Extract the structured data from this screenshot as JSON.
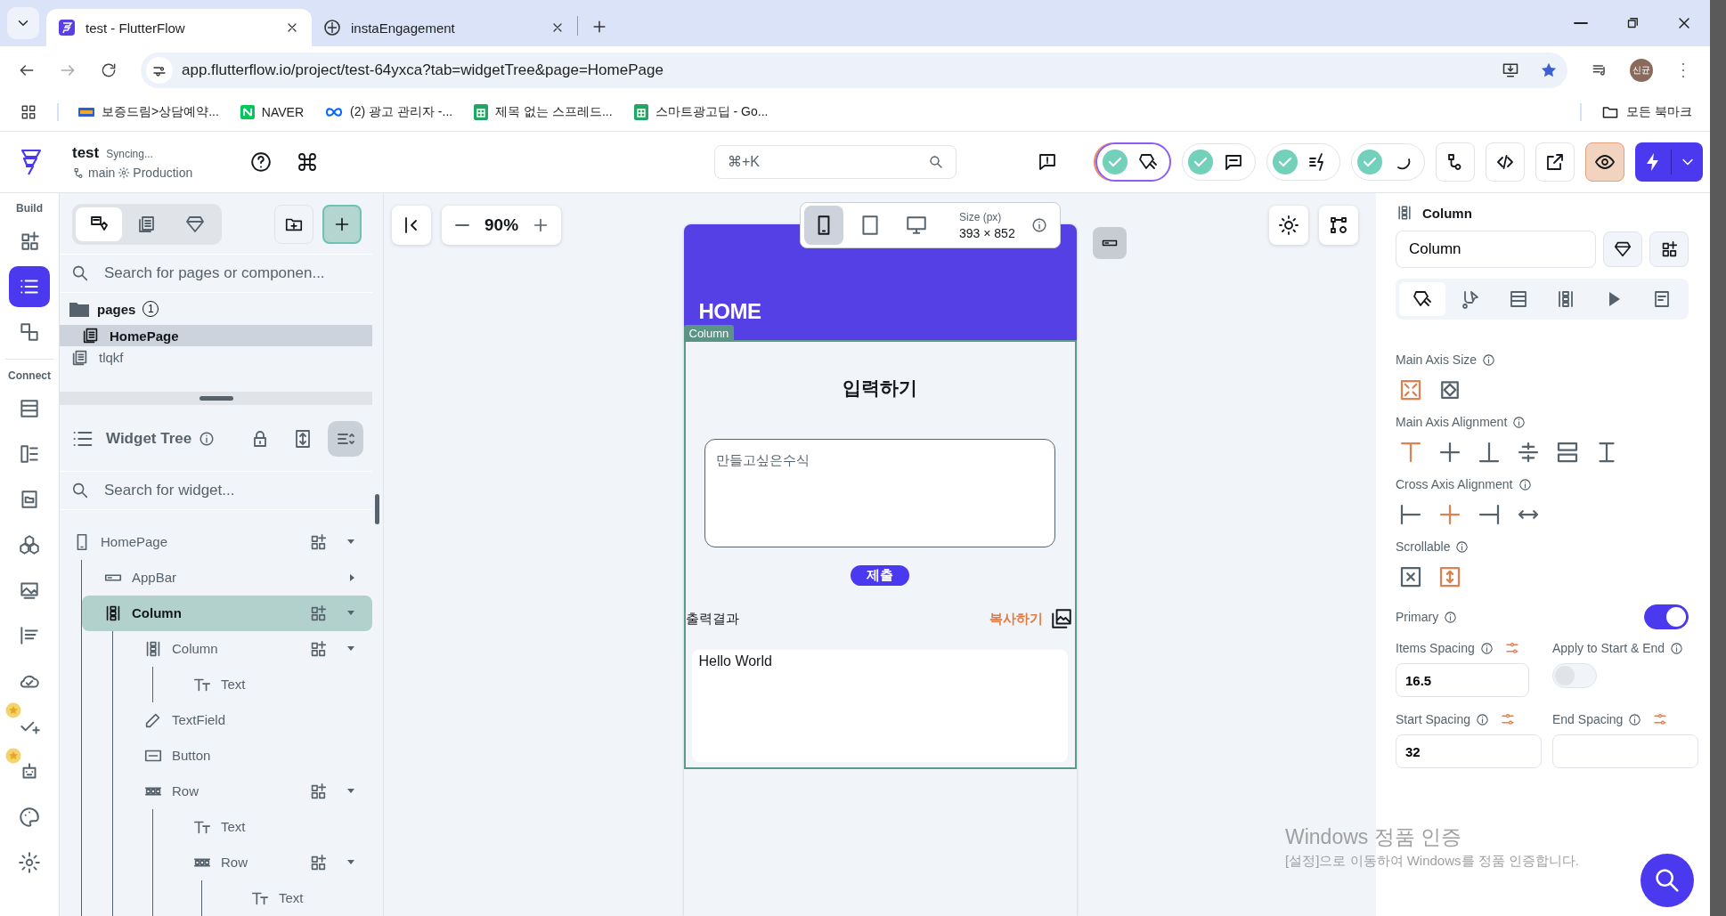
{
  "browser": {
    "tabs": [
      {
        "title": "test - FlutterFlow",
        "kind": "flutterflow",
        "selected": true
      },
      {
        "title": "instaEngagement",
        "kind": "ae",
        "selected": false
      }
    ],
    "url": "app.flutterflow.io/project/test-64yxca?tab=widgetTree&page=HomePage",
    "profile": "신균",
    "bookmarks": [
      {
        "label": "보증드림>상담예약...",
        "kind": "site"
      },
      {
        "label": "NAVER",
        "kind": "naver"
      },
      {
        "label": "(2) 광고 관리자 -...",
        "kind": "meta"
      },
      {
        "label": "제목 없는 스프레드...",
        "kind": "sheets"
      },
      {
        "label": "스마트광고딥 - Go...",
        "kind": "sheets"
      }
    ],
    "all_bookmarks": "모든 북마크"
  },
  "project": {
    "name": "test",
    "status": "Syncing...",
    "branch": "main",
    "environment": "Production"
  },
  "search": {
    "placeholder": "⌘+K"
  },
  "toolbar": {
    "pills": [
      {
        "kind": "design",
        "checked": true
      },
      {
        "kind": "chat",
        "checked": true
      },
      {
        "kind": "actions",
        "checked": true
      },
      {
        "kind": "moon",
        "checked": true
      }
    ],
    "buttons": [
      {
        "kind": "flow",
        "selected": false
      },
      {
        "kind": "code",
        "selected": false
      },
      {
        "kind": "external",
        "selected": false
      },
      {
        "kind": "eye",
        "selected": true
      }
    ]
  },
  "rail": {
    "sections": [
      {
        "label": "Build",
        "items": [
          {
            "kind": "add-widget",
            "selected": false,
            "premium": false
          },
          {
            "kind": "tree",
            "selected": true,
            "premium": false
          },
          {
            "kind": "components",
            "selected": false,
            "premium": false
          }
        ]
      },
      {
        "label": "Connect",
        "items": [
          {
            "kind": "database",
            "selected": false,
            "premium": false
          },
          {
            "kind": "api",
            "selected": false,
            "premium": false
          },
          {
            "kind": "storage",
            "selected": false,
            "premium": false
          },
          {
            "kind": "integrations",
            "selected": false,
            "premium": false
          },
          {
            "kind": "media",
            "selected": false,
            "premium": false
          },
          {
            "kind": "content",
            "selected": false,
            "premium": false
          },
          {
            "kind": "cloud",
            "selected": false,
            "premium": false
          },
          {
            "kind": "tests",
            "selected": false,
            "premium": true
          },
          {
            "kind": "agent",
            "selected": false,
            "premium": true
          },
          {
            "kind": "theme",
            "selected": false,
            "premium": false
          },
          {
            "kind": "settings",
            "selected": false,
            "premium": false
          }
        ]
      }
    ]
  },
  "pages_panel": {
    "tabs": [
      {
        "kind": "widgets",
        "selected": true
      },
      {
        "kind": "pages",
        "selected": false
      },
      {
        "kind": "library",
        "selected": false
      }
    ],
    "search": {
      "placeholder": "Search for pages or componen..."
    },
    "folder": {
      "label": "pages",
      "count": "1",
      "pages": [
        {
          "label": "HomePage",
          "selected": true
        }
      ]
    },
    "other_pages": [
      {
        "label": "tlqkf",
        "selected": false
      }
    ]
  },
  "widget_tree": {
    "title": "Widget Tree",
    "search": {
      "placeholder": "Search for widget..."
    },
    "nodes": [
      {
        "label": "HomePage",
        "kind": "page",
        "expanded": true,
        "selected": false,
        "children": [
          {
            "label": "AppBar",
            "kind": "appbar",
            "expanded": false,
            "selected": false
          },
          {
            "label": "Column",
            "kind": "column",
            "expanded": true,
            "selected": true,
            "children": [
              {
                "label": "Column",
                "kind": "column",
                "expanded": true,
                "selected": false,
                "children": [
                  {
                    "label": "Text",
                    "kind": "text",
                    "selected": false
                  }
                ]
              },
              {
                "label": "TextField",
                "kind": "textfield",
                "selected": false
              },
              {
                "label": "Button",
                "kind": "button",
                "selected": false
              },
              {
                "label": "Row",
                "kind": "row",
                "expanded": true,
                "selected": false,
                "children": [
                  {
                    "label": "Text",
                    "kind": "text",
                    "selected": false
                  },
                  {
                    "label": "Row",
                    "kind": "row",
                    "expanded": true,
                    "selected": false,
                    "children": [
                      {
                        "label": "Text",
                        "kind": "text",
                        "selected": false
                      }
                    ]
                  }
                ]
              }
            ]
          }
        ]
      }
    ]
  },
  "canvas": {
    "zoom": "90%",
    "devices": [
      {
        "kind": "phone",
        "selected": true
      },
      {
        "kind": "tablet",
        "selected": false
      },
      {
        "kind": "desktop",
        "selected": false
      }
    ],
    "size_label": "Size (px)",
    "size": "393 × 852",
    "phone": {
      "app_bar_title": "HOME",
      "selection_tag": "Column",
      "heading": "입력하기",
      "field": {
        "placeholder": "만들고싶은수식"
      },
      "button": "제출",
      "output_label": "출력결과",
      "copy_label": "복사하기",
      "output": "Hello World"
    }
  },
  "properties": {
    "widget": "Column",
    "name": "Column",
    "tabs": [
      {
        "kind": "design",
        "selected": true
      },
      {
        "kind": "interaction",
        "selected": false
      },
      {
        "kind": "backend",
        "selected": false
      },
      {
        "kind": "column",
        "selected": false
      },
      {
        "kind": "play",
        "selected": false
      },
      {
        "kind": "notes",
        "selected": false
      }
    ],
    "groups": [
      {
        "label": "Main Axis Size",
        "options": [
          {
            "kind": "min",
            "selected": true
          },
          {
            "kind": "max",
            "selected": false
          }
        ]
      },
      {
        "label": "Main Axis Alignment",
        "options": [
          {
            "kind": "al-start",
            "selected": true
          },
          {
            "kind": "al-center",
            "selected": false
          },
          {
            "kind": "al-end",
            "selected": false
          },
          {
            "kind": "al-between",
            "selected": false
          },
          {
            "kind": "al-around",
            "selected": false
          },
          {
            "kind": "al-evenly",
            "selected": false
          }
        ]
      },
      {
        "label": "Cross Axis Alignment",
        "options": [
          {
            "kind": "cr-start",
            "selected": false
          },
          {
            "kind": "cr-center",
            "selected": true
          },
          {
            "kind": "cr-end",
            "selected": false
          },
          {
            "kind": "cr-stretch",
            "selected": false
          }
        ]
      },
      {
        "label": "Scrollable",
        "options": [
          {
            "kind": "off",
            "selected": false
          },
          {
            "kind": "scroll",
            "selected": true
          }
        ]
      }
    ],
    "primary": {
      "label": "Primary",
      "on": true
    },
    "items_spacing": {
      "label": "Items Spacing",
      "value": "16.5"
    },
    "apply": {
      "label": "Apply to Start & End",
      "on": false
    },
    "start_spacing": {
      "label": "Start Spacing",
      "value": "32"
    },
    "end_spacing": {
      "label": "End Spacing"
    }
  },
  "os_notice": {
    "title": "Windows 정품 인증",
    "text": "[설정]으로 이동하여 Windows를 정품 인증합니다."
  }
}
